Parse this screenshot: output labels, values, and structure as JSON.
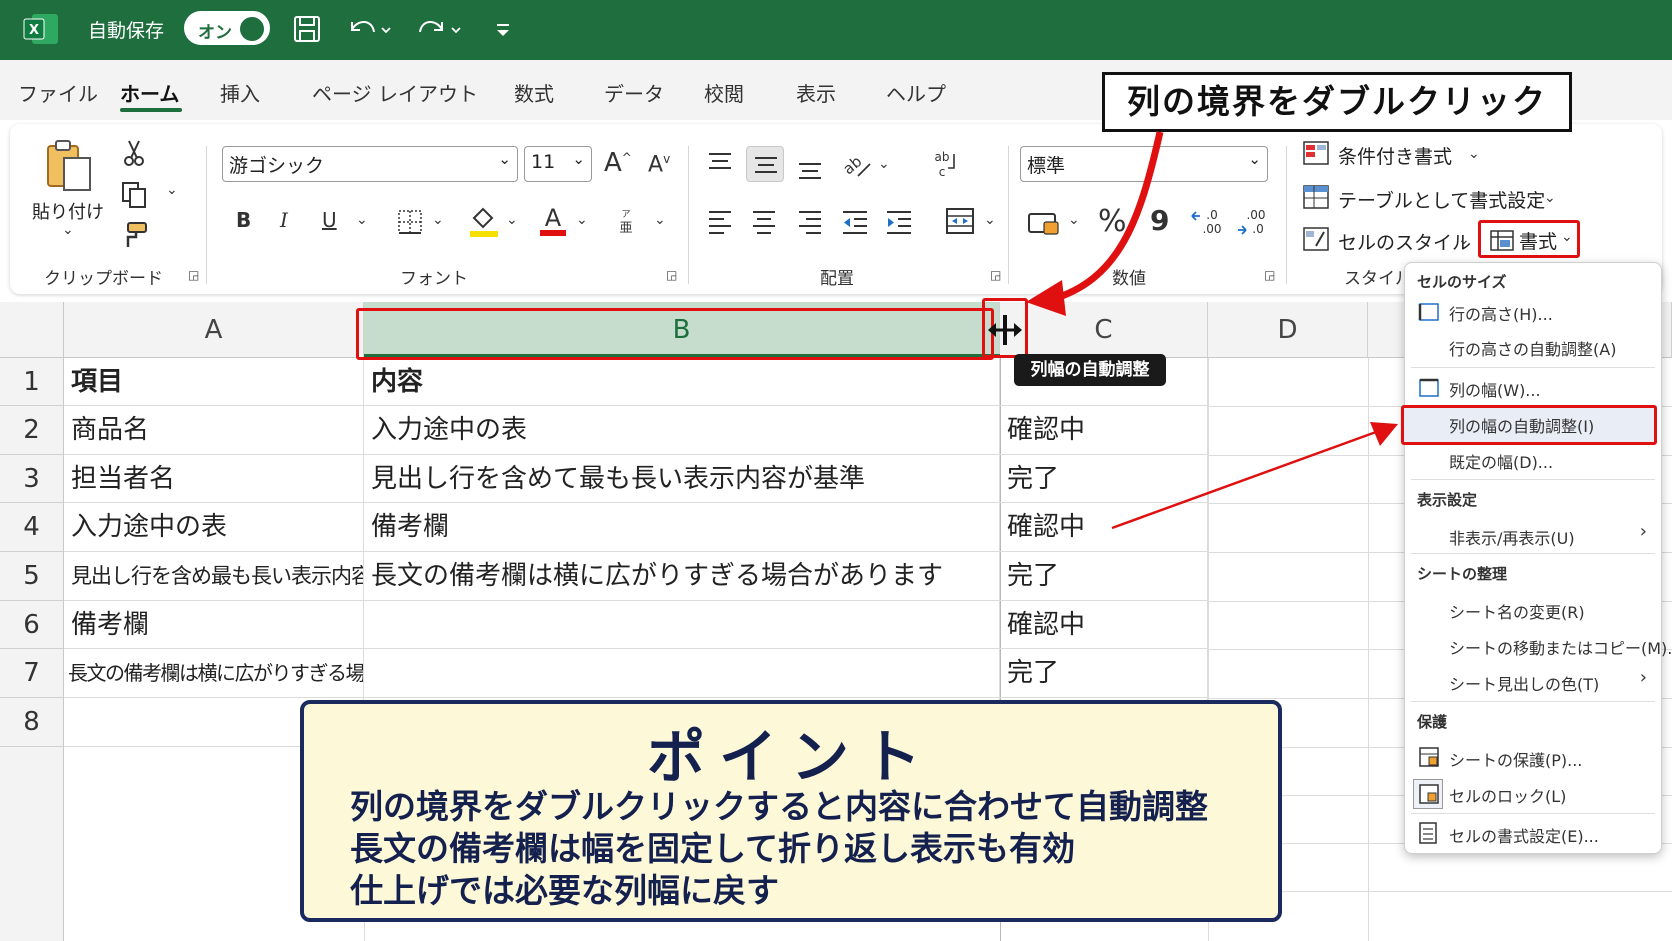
{
  "app": {
    "autosave_label": "自動保存",
    "autosave_state": "オン"
  },
  "tabs": [
    "ファイル",
    "ホーム",
    "挿入",
    "ページ レイアウト",
    "数式",
    "データ",
    "校閲",
    "表示",
    "ヘルプ"
  ],
  "ribbon": {
    "clipboard": {
      "paste_label": "貼り付け",
      "group_label": "クリップボード"
    },
    "font": {
      "font_name": "游ゴシック",
      "font_size": "11",
      "group_label": "フォント",
      "bold": "B",
      "italic": "I",
      "underline": "U"
    },
    "alignment": {
      "group_label": "配置"
    },
    "number": {
      "format": "標準",
      "group_label": "数値",
      "percent": "%",
      "comma": "9"
    },
    "styles": {
      "conditional": "条件付き書式",
      "as_table": "テーブルとして書式設定",
      "cell_style": "セルのスタイル",
      "group_label": "スタイル"
    },
    "cells": {
      "format_label": "書式"
    }
  },
  "sheet": {
    "columns": [
      "A",
      "B",
      "C",
      "D"
    ],
    "rows": [
      "1",
      "2",
      "3",
      "4",
      "5",
      "6",
      "7",
      "8"
    ],
    "cells": {
      "a1": "項目",
      "b1": "内容",
      "a2": "商品名",
      "b2": "入力途中の表",
      "c2": "確認中",
      "a3": "担当者名",
      "b3": "見出し行を含めて最も長い表示内容が基準",
      "c3": "完了",
      "a4": "入力途中の表",
      "b4": "備考欄",
      "c4": "確認中",
      "a5": "見出し行を含め最も長い表示内容が基準",
      "b5": "長文の備考欄は横に広がりすぎる場合があります",
      "c5": "完了",
      "a6": "備考欄",
      "c6": "確認中",
      "a7": "長文の備考欄は横に広がりすぎる場合があります",
      "c7": "完了"
    }
  },
  "menu": {
    "header_size": "セルのサイズ",
    "row_height": "行の高さ(H)...",
    "row_autofit": "行の高さの自動調整(A)",
    "col_width": "列の幅(W)...",
    "col_autofit": "列の幅の自動調整(I)",
    "default_width": "既定の幅(D)...",
    "header_visibility": "表示設定",
    "hide_unhide": "非表示/再表示(U)",
    "header_organize": "シートの整理",
    "rename": "シート名の変更(R)",
    "move_copy": "シートの移動またはコピー(M)...",
    "tab_color": "シート見出しの色(T)",
    "header_protect": "保護",
    "protect_sheet": "シートの保護(P)...",
    "lock_cell": "セルのロック(L)",
    "format_cells": "セルの書式設定(E)..."
  },
  "callout": "列の境界をダブルクリック",
  "tooltip": "列幅の自動調整",
  "point": {
    "title": "ポイント",
    "lines": [
      "列の境界をダブルクリックすると内容に合わせて自動調整",
      "長文の備考欄は幅を固定して折り返し表示も有効",
      "仕上げでは必要な列幅に戻す"
    ]
  },
  "colors": {
    "excel_green": "#1e6e3e",
    "highlight_red": "#e01010",
    "point_navy": "#1a2a5e",
    "point_bg": "#fdf8d8",
    "selected_column": "#c6dccd"
  }
}
